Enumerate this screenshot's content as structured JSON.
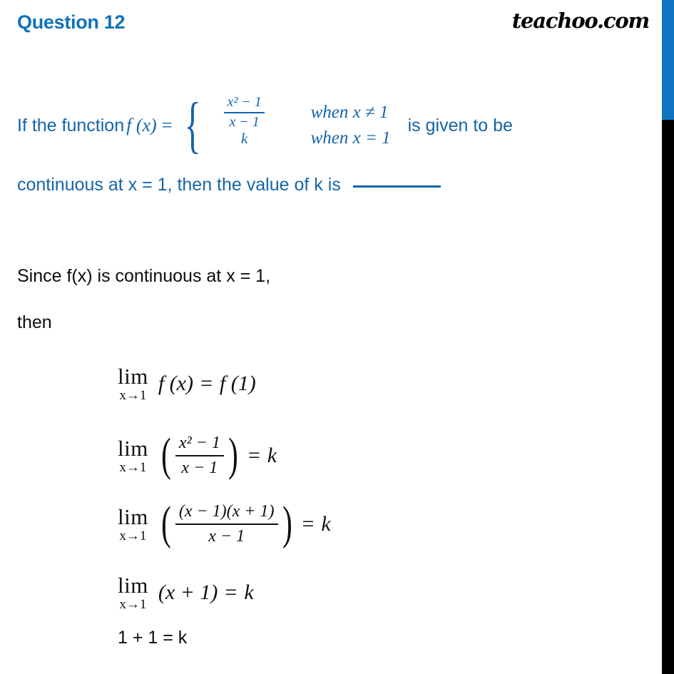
{
  "header": {
    "question_title": "Question 12",
    "brand": "teachoo.com",
    "title_color": "#1072b8",
    "brand_color": "#000000"
  },
  "decor": {
    "edge_bar_blue_color": "#1075c0",
    "edge_bar_black_color": "#000000"
  },
  "question": {
    "color": "#1565a8",
    "intro": "If the function",
    "fn_name": "f (x)",
    "equals": "=",
    "piecewise": {
      "brace": "{",
      "cases": [
        {
          "value_type": "fraction",
          "numerator": "x² − 1",
          "denominator": "x − 1",
          "condition": "when x ≠ 1"
        },
        {
          "value_type": "plain",
          "value": "k",
          "condition": "when x = 1"
        }
      ]
    },
    "tail": "is given to be",
    "line2": "continuous at x = 1, then the value of k is",
    "blank": "________"
  },
  "solution": {
    "color": "#0d0d0d",
    "line1": "Since f(x) is continuous at x = 1,",
    "line2": "then",
    "equations": [
      {
        "id": "limit-fx-equals-f1",
        "lim_main": "lim",
        "lim_sub": "x→1",
        "body": "f (x)",
        "relation": "=",
        "rhs": "f (1)"
      },
      {
        "id": "limit-fraction-equals-k",
        "lim_main": "lim",
        "lim_sub": "x→1",
        "numerator": "x² − 1",
        "denominator": "x − 1",
        "relation": "=",
        "rhs": "k"
      },
      {
        "id": "limit-factored-equals-k",
        "lim_main": "lim",
        "lim_sub": "x→1",
        "numerator": "(x − 1)(x + 1)",
        "denominator": "x − 1",
        "relation": "=",
        "rhs": "k"
      },
      {
        "id": "limit-x-plus-1-equals-k",
        "lim_main": "lim",
        "lim_sub": "x→1",
        "body": "(x + 1)",
        "relation": "=",
        "rhs": "k"
      },
      {
        "id": "one-plus-one-equals-k",
        "text": "1 + 1 = k"
      }
    ]
  }
}
